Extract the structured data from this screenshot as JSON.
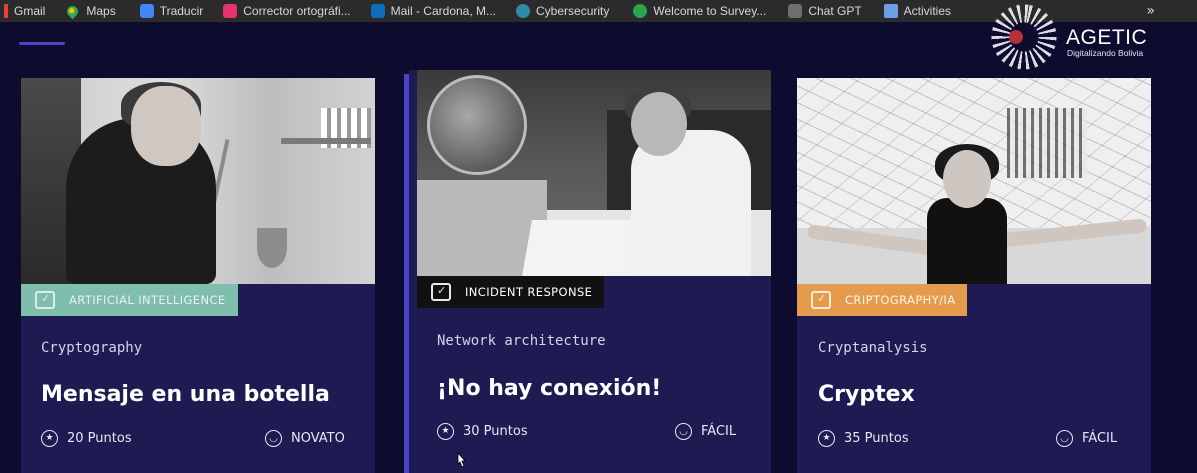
{
  "bookmarks": [
    {
      "label": "Gmail",
      "icon": "gmail-icon"
    },
    {
      "label": "Maps",
      "icon": "maps-icon"
    },
    {
      "label": "Traducir",
      "icon": "translate-icon"
    },
    {
      "label": "Corrector ortográfi...",
      "icon": "spellcheck-icon"
    },
    {
      "label": "Mail - Cardona, M...",
      "icon": "outlook-icon"
    },
    {
      "label": "Cybersecurity",
      "icon": "cybersecurity-icon"
    },
    {
      "label": "Welcome to Survey...",
      "icon": "survey-icon"
    },
    {
      "label": "Chat GPT",
      "icon": "chatgpt-icon"
    },
    {
      "label": "Activities",
      "icon": "activities-icon"
    }
  ],
  "bookmarks_overflow_label": "»",
  "logo": {
    "name": "AGETIC",
    "tagline": "Digitalizando Bolivia"
  },
  "cards": [
    {
      "category": "ARTIFICIAL INTELLIGENCE",
      "category_color": "#7fbdad",
      "subtitle": "Cryptography",
      "title": "Mensaje en una botella",
      "points": "20 Puntos",
      "level": "NOVATO"
    },
    {
      "category": "INCIDENT RESPONSE",
      "category_color": "#111111",
      "subtitle": "Network architecture",
      "title": "¡No hay conexión!",
      "points": "30 Puntos",
      "level": "FÁCIL"
    },
    {
      "category": "CRIPTOGRAPHY/IA",
      "category_color": "#e49b4d",
      "subtitle": "Cryptanalysis",
      "title": "Cryptex",
      "points": "35 Puntos",
      "level": "FÁCIL"
    }
  ],
  "colors": {
    "background": "#0d0b2e",
    "card": "#1e1a52",
    "accent": "#4b43c9"
  }
}
